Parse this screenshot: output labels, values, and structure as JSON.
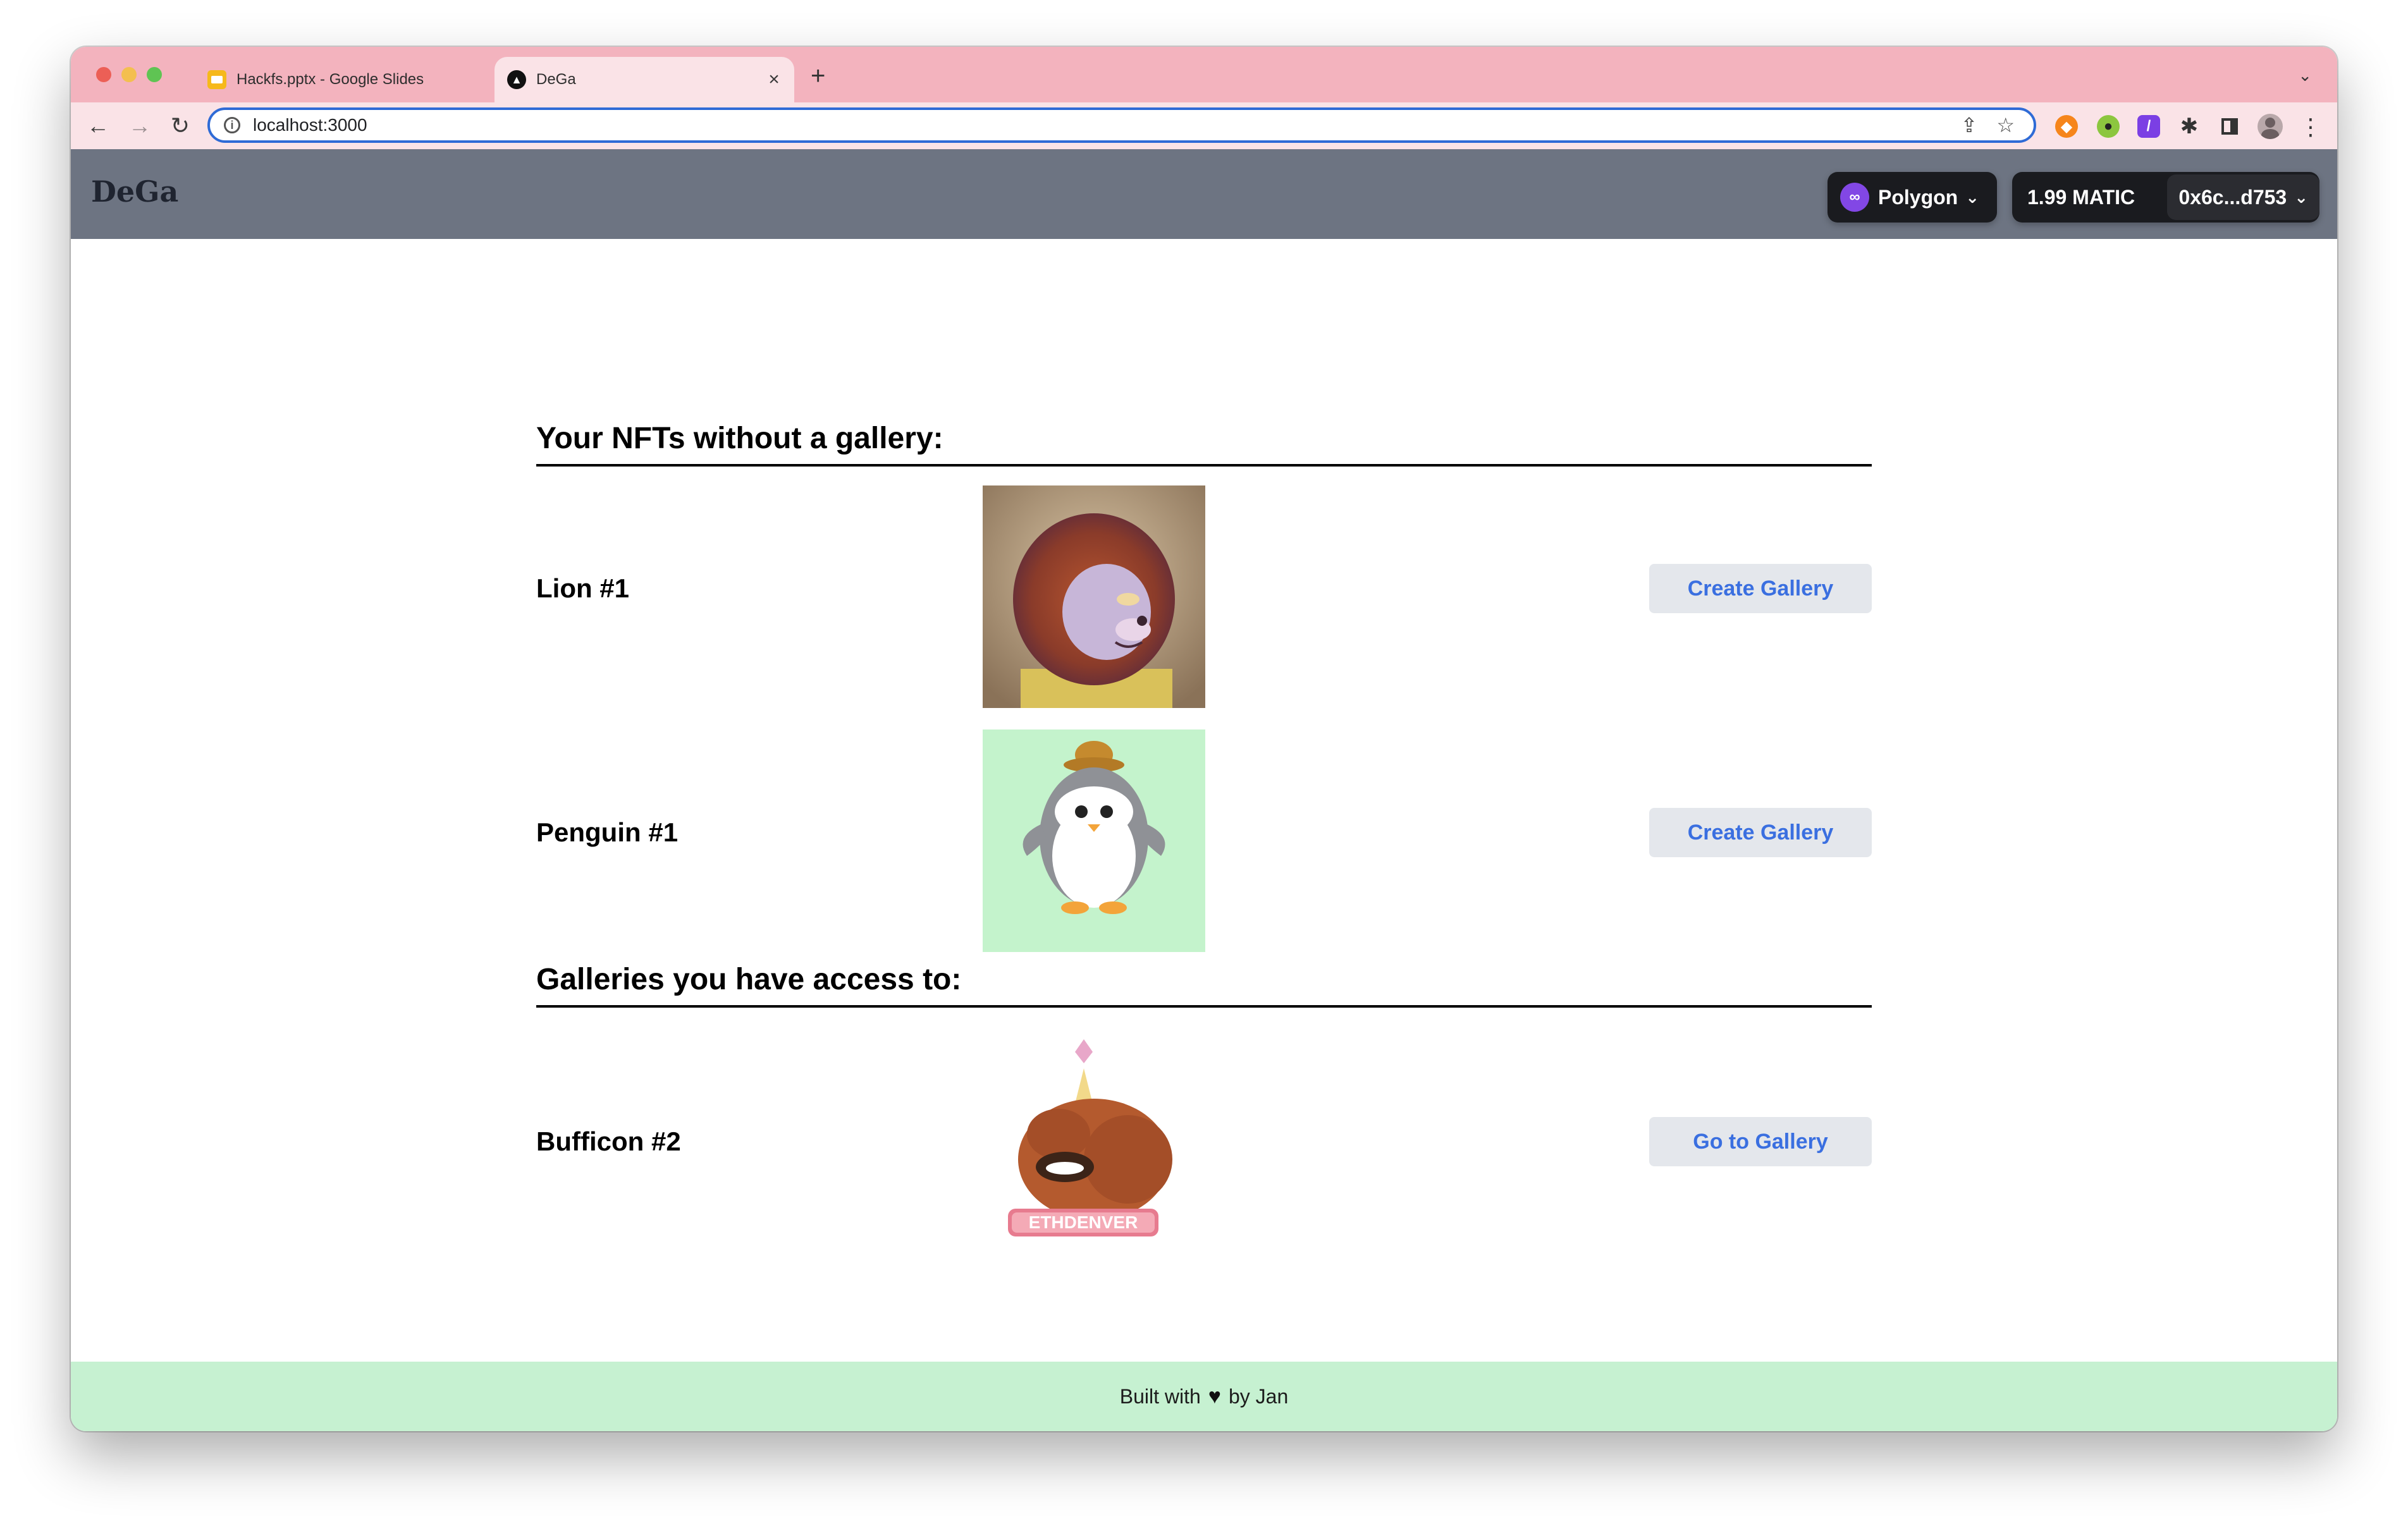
{
  "browser": {
    "tabs": [
      {
        "title": "Hackfs.pptx - Google Slides",
        "active": false
      },
      {
        "title": "DeGa",
        "active": true
      }
    ],
    "url": "localhost:3000"
  },
  "navbar": {
    "brand": "DeGa",
    "chain": "Polygon",
    "balance": "1.99 MATIC",
    "address": "0x6c...d753"
  },
  "sections": {
    "without_gallery": {
      "heading": "Your NFTs without a gallery:",
      "items": [
        {
          "name": "Lion #1",
          "button": "Create Gallery"
        },
        {
          "name": "Penguin #1",
          "button": "Create Gallery"
        }
      ]
    },
    "access": {
      "heading": "Galleries you have access to:",
      "items": [
        {
          "name": "Bufficon #2",
          "button": "Go to Gallery",
          "banner": "ETHDENVER"
        }
      ]
    }
  },
  "footer": {
    "prefix": "Built with",
    "suffix": "by Jan"
  }
}
